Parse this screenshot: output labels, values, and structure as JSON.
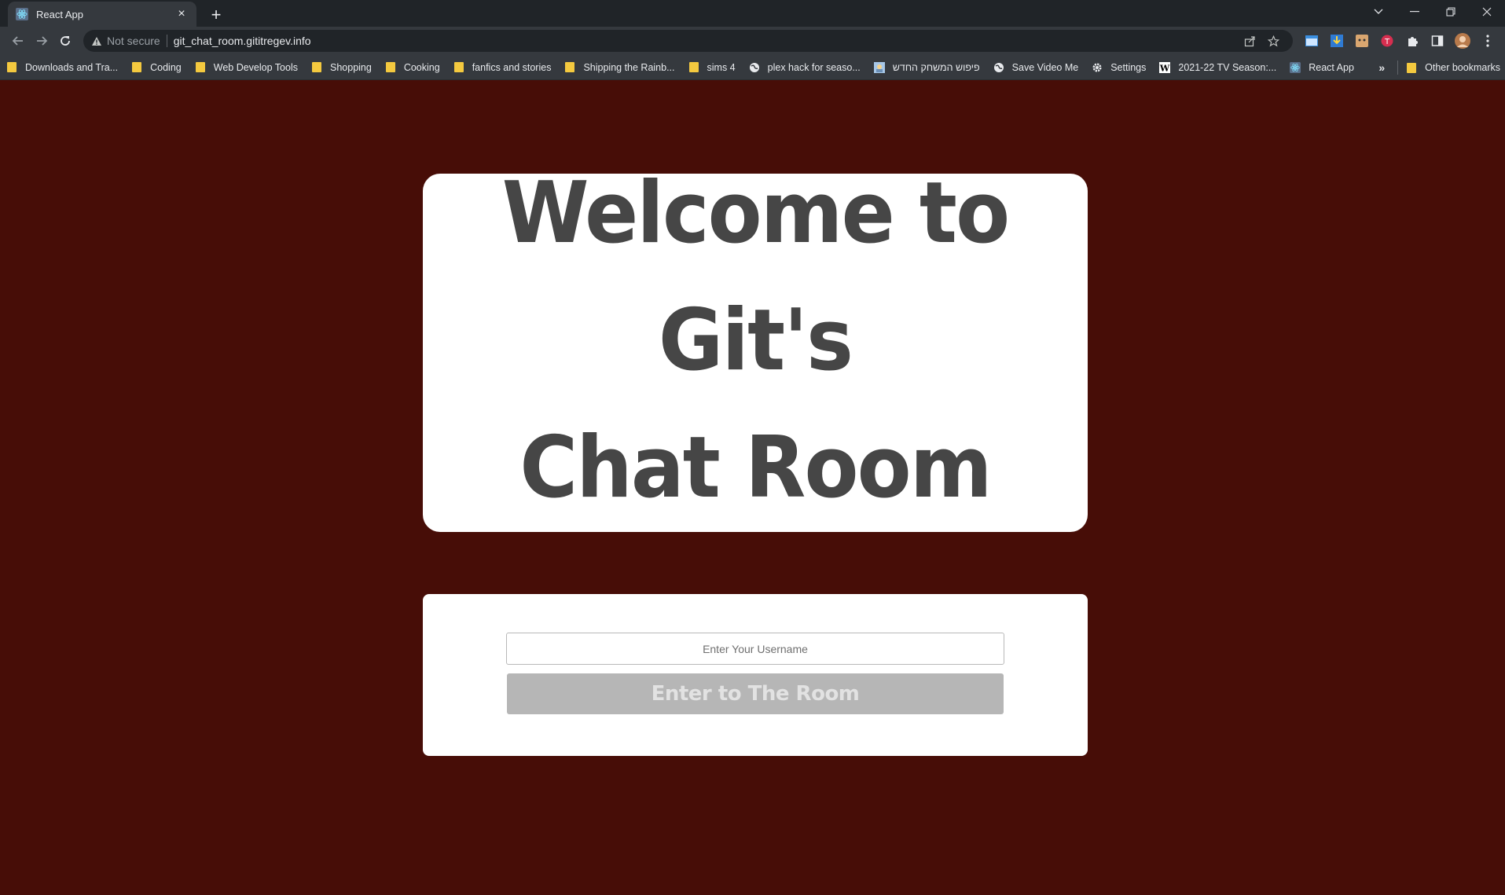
{
  "browser": {
    "tab_title": "React App",
    "tab_close": "×",
    "new_tab": "+",
    "security_label": "Not secure",
    "url": "git_chat_room.gititregev.info"
  },
  "bookmarks": {
    "items": [
      {
        "label": "Downloads and Tra...",
        "icon": "folder-icon"
      },
      {
        "label": "Coding",
        "icon": "folder-icon"
      },
      {
        "label": "Web Develop Tools",
        "icon": "folder-icon"
      },
      {
        "label": "Shopping",
        "icon": "folder-icon"
      },
      {
        "label": "Cooking",
        "icon": "folder-icon"
      },
      {
        "label": "fanfics and stories",
        "icon": "folder-icon"
      },
      {
        "label": "Shipping the Rainb...",
        "icon": "folder-icon"
      },
      {
        "label": "sims 4",
        "icon": "folder-icon"
      },
      {
        "label": "plex hack for seaso...",
        "icon": "globe-icon"
      },
      {
        "label": "פיפוש המשחק החדש",
        "icon": "game-icon"
      },
      {
        "label": "Save Video Me",
        "icon": "globe-icon"
      },
      {
        "label": "Settings",
        "icon": "gear-icon"
      },
      {
        "label": "2021-22 TV Season:...",
        "icon": "wikipedia-icon"
      },
      {
        "label": "React App",
        "icon": "react-icon"
      }
    ],
    "more": "»",
    "other": "Other bookmarks"
  },
  "page": {
    "welcome_line1": "Welcome to Git's",
    "welcome_line2": "Chat Room",
    "username_placeholder": "Enter Your Username",
    "enter_button": "Enter to The Room"
  },
  "colors": {
    "page_background": "#470d07",
    "card_background": "#ffffff",
    "title_text": "#464646",
    "button_disabled": "#b6b6b6"
  }
}
